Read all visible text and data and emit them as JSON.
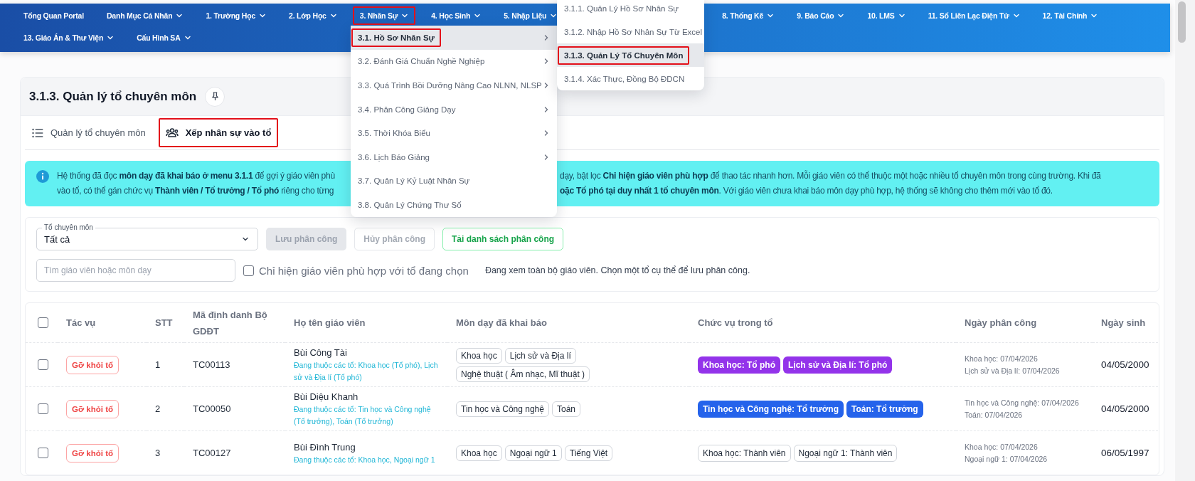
{
  "menu_bar": {
    "rows": [
      {
        "items": [
          {
            "label": "Tổng Quan Portal",
            "has_menu": false,
            "highlighted": false
          },
          {
            "label": "Danh Mục Cá Nhân",
            "has_menu": true,
            "highlighted": false
          },
          {
            "label": "1. Trường Học",
            "has_menu": true,
            "highlighted": false
          },
          {
            "label": "2. Lớp Học",
            "has_menu": true,
            "highlighted": false
          },
          {
            "label": "3. Nhân Sự",
            "has_menu": true,
            "highlighted": true
          },
          {
            "label": "4. Học Sinh",
            "has_menu": true,
            "highlighted": false
          },
          {
            "label": "5. Nhập Liệu",
            "has_menu": true,
            "highlighted": false
          },
          {
            "label": "8. Thống Kê",
            "has_menu": true,
            "highlighted": false
          },
          {
            "label": "9. Báo Cáo",
            "has_menu": true,
            "highlighted": false
          },
          {
            "label": "10. LMS",
            "has_menu": true,
            "highlighted": false
          },
          {
            "label": "11. Sổ Liên Lạc Điện Tử",
            "has_menu": true,
            "highlighted": false
          },
          {
            "label": "12. Tài Chính",
            "has_menu": true,
            "highlighted": false
          }
        ]
      },
      {
        "items": [
          {
            "label": "13. Giáo Án & Thư Viện",
            "has_menu": true,
            "highlighted": false
          },
          {
            "label": "Cấu Hình SA",
            "has_menu": true,
            "highlighted": false
          }
        ]
      }
    ]
  },
  "dropdown": {
    "items": [
      {
        "label": "3.1. Hồ Sơ Nhân Sự",
        "has_submenu": true,
        "selected": true,
        "highlighted": true
      },
      {
        "label": "3.2. Đánh Giá Chuẩn Nghề Nghiệp",
        "has_submenu": true,
        "selected": false,
        "highlighted": false
      },
      {
        "label": "3.3. Quá Trình Bồi Dưỡng Nâng Cao NLNN, NLSP",
        "has_submenu": true,
        "selected": false,
        "highlighted": false
      },
      {
        "label": "3.4. Phân Công Giảng Dạy",
        "has_submenu": true,
        "selected": false,
        "highlighted": false
      },
      {
        "label": "3.5. Thời Khóa Biểu",
        "has_submenu": true,
        "selected": false,
        "highlighted": false
      },
      {
        "label": "3.6. Lịch Báo Giảng",
        "has_submenu": true,
        "selected": false,
        "highlighted": false
      },
      {
        "label": "3.7. Quản Lý Kỷ Luật Nhân Sự",
        "has_submenu": false,
        "selected": false,
        "highlighted": false
      },
      {
        "label": "3.8. Quản Lý Chứng Thư Số",
        "has_submenu": false,
        "selected": false,
        "highlighted": false
      }
    ]
  },
  "submenu": {
    "items": [
      {
        "label": "3.1.1. Quản Lý Hồ Sơ Nhân Sự",
        "selected": false,
        "highlighted": false
      },
      {
        "label": "3.1.2. Nhập Hồ Sơ Nhân Sự Từ Excel",
        "selected": false,
        "highlighted": false
      },
      {
        "label": "3.1.3. Quản Lý Tổ Chuyên Môn",
        "selected": true,
        "highlighted": true
      },
      {
        "label": "3.1.4. Xác Thực, Đồng Bộ ĐDCN",
        "selected": false,
        "highlighted": false
      }
    ]
  },
  "card": {
    "title": "3.1.3. Quản lý tổ chuyên môn"
  },
  "tabs": [
    {
      "label": "Quản lý tổ chuyên môn",
      "kind": "list",
      "selected": false,
      "highlighted": false
    },
    {
      "label": "Xếp nhân sự vào tổ",
      "kind": "users",
      "selected": true,
      "highlighted": true
    }
  ],
  "alert": {
    "lines": [
      {
        "left": "Hệ thống đã đọc **môn dạy đã khai báo ở menu 3.1.1** để gợi ý giáo viên phù",
        "right": "dạy, bật lọc **Chỉ hiện giáo viên phù hợp** để thao tác nhanh hơn. Mỗi giáo viên có thể thuộc một hoặc nhiều tổ chuyên môn trong cùng trường. Khi đã"
      },
      {
        "left": "vào tổ, có thể gán chức vụ **Thành viên / Tổ trưởng / Tổ phó** riêng cho từng",
        "right": "**oặc Tổ phó tại duy nhất 1 tổ chuyên môn**. Với giáo viên chưa khai báo môn dạy phù hợp, hệ thống sẽ không cho thêm mới vào tổ đó."
      }
    ]
  },
  "filters": {
    "team_select": {
      "label": "Tổ chuyên môn",
      "value": "Tất cả"
    },
    "buttons": [
      {
        "label": "Lưu phân công",
        "kind": "filled",
        "disabled": true
      },
      {
        "label": "Hủy phân công",
        "kind": "outline",
        "disabled": true
      },
      {
        "label": "Tải danh sách phân công",
        "kind": "success",
        "disabled": false
      }
    ],
    "search": {
      "placeholder": "Tìm giáo viên hoặc môn dạy"
    },
    "match_filter": {
      "label": "Chỉ hiện giáo viên phù hợp với tổ đang chọn",
      "checked": false
    },
    "status": "Đang xem toàn bộ giáo viên. Chọn một tổ cụ thể để lưu phân công."
  },
  "table": {
    "select_all_checked": false,
    "columns": [
      "Tác vụ",
      "STT",
      "Mã định danh Bộ GDĐT",
      "Họ tên giáo viên",
      "Môn dạy đã khai báo",
      "Chức vụ trong tổ",
      "Ngày phân công",
      "Ngày sinh"
    ],
    "rows": [
      {
        "checked": false,
        "action": "Gỡ khỏi tổ",
        "stt": "1",
        "code": "TC00113",
        "name": "Bùi Công Tài",
        "membership": "Đang thuộc các tổ: Khoa học (Tổ phó), Lịch sử và Địa lí (Tổ phó)",
        "subjects": [
          "Khoa học",
          "Lịch sử và Địa lí",
          "Nghệ thuật ( Âm nhạc, Mĩ thuật )"
        ],
        "roles": [
          {
            "label": "Khoa học: Tổ phó",
            "kind": "deputy"
          },
          {
            "label": "Lịch sử và Địa lí: Tổ phó",
            "kind": "deputy"
          }
        ],
        "assigned": [
          "Khoa học: 07/04/2026",
          "Lịch sử và Địa lí: 07/04/2026"
        ],
        "birth_date": "04/05/2000"
      },
      {
        "checked": false,
        "action": "Gỡ khỏi tổ",
        "stt": "2",
        "code": "TC00050",
        "name": "Bùi Diệu Khanh",
        "membership": "Đang thuộc các tổ: Tin học và Công nghệ (Tổ trưởng), Toán (Tổ trưởng)",
        "subjects": [
          "Tin học và Công nghệ",
          "Toán"
        ],
        "roles": [
          {
            "label": "Tin học và Công nghệ: Tổ trưởng",
            "kind": "head"
          },
          {
            "label": "Toán: Tổ trưởng",
            "kind": "head"
          }
        ],
        "assigned": [
          "Tin học và Công nghệ: 07/04/2026",
          "Toán: 07/04/2026"
        ],
        "birth_date": "04/05/2000"
      },
      {
        "checked": false,
        "action": "Gỡ khỏi tổ",
        "stt": "3",
        "code": "TC00127",
        "name": "Bùi Đình Trung",
        "membership": "Đang thuộc các tổ: Khoa học, Ngoại ngữ 1",
        "subjects": [
          "Khoa học",
          "Ngoại ngữ 1",
          "Tiếng Việt"
        ],
        "roles": [
          {
            "label": "Khoa học: Thành viên",
            "kind": "member"
          },
          {
            "label": "Ngoại ngữ 1: Thành viên",
            "kind": "member"
          }
        ],
        "assigned": [
          "Khoa học: 07/04/2026",
          "Ngoại ngữ 1: 07/04/2026"
        ],
        "birth_date": "06/05/1997"
      }
    ]
  }
}
